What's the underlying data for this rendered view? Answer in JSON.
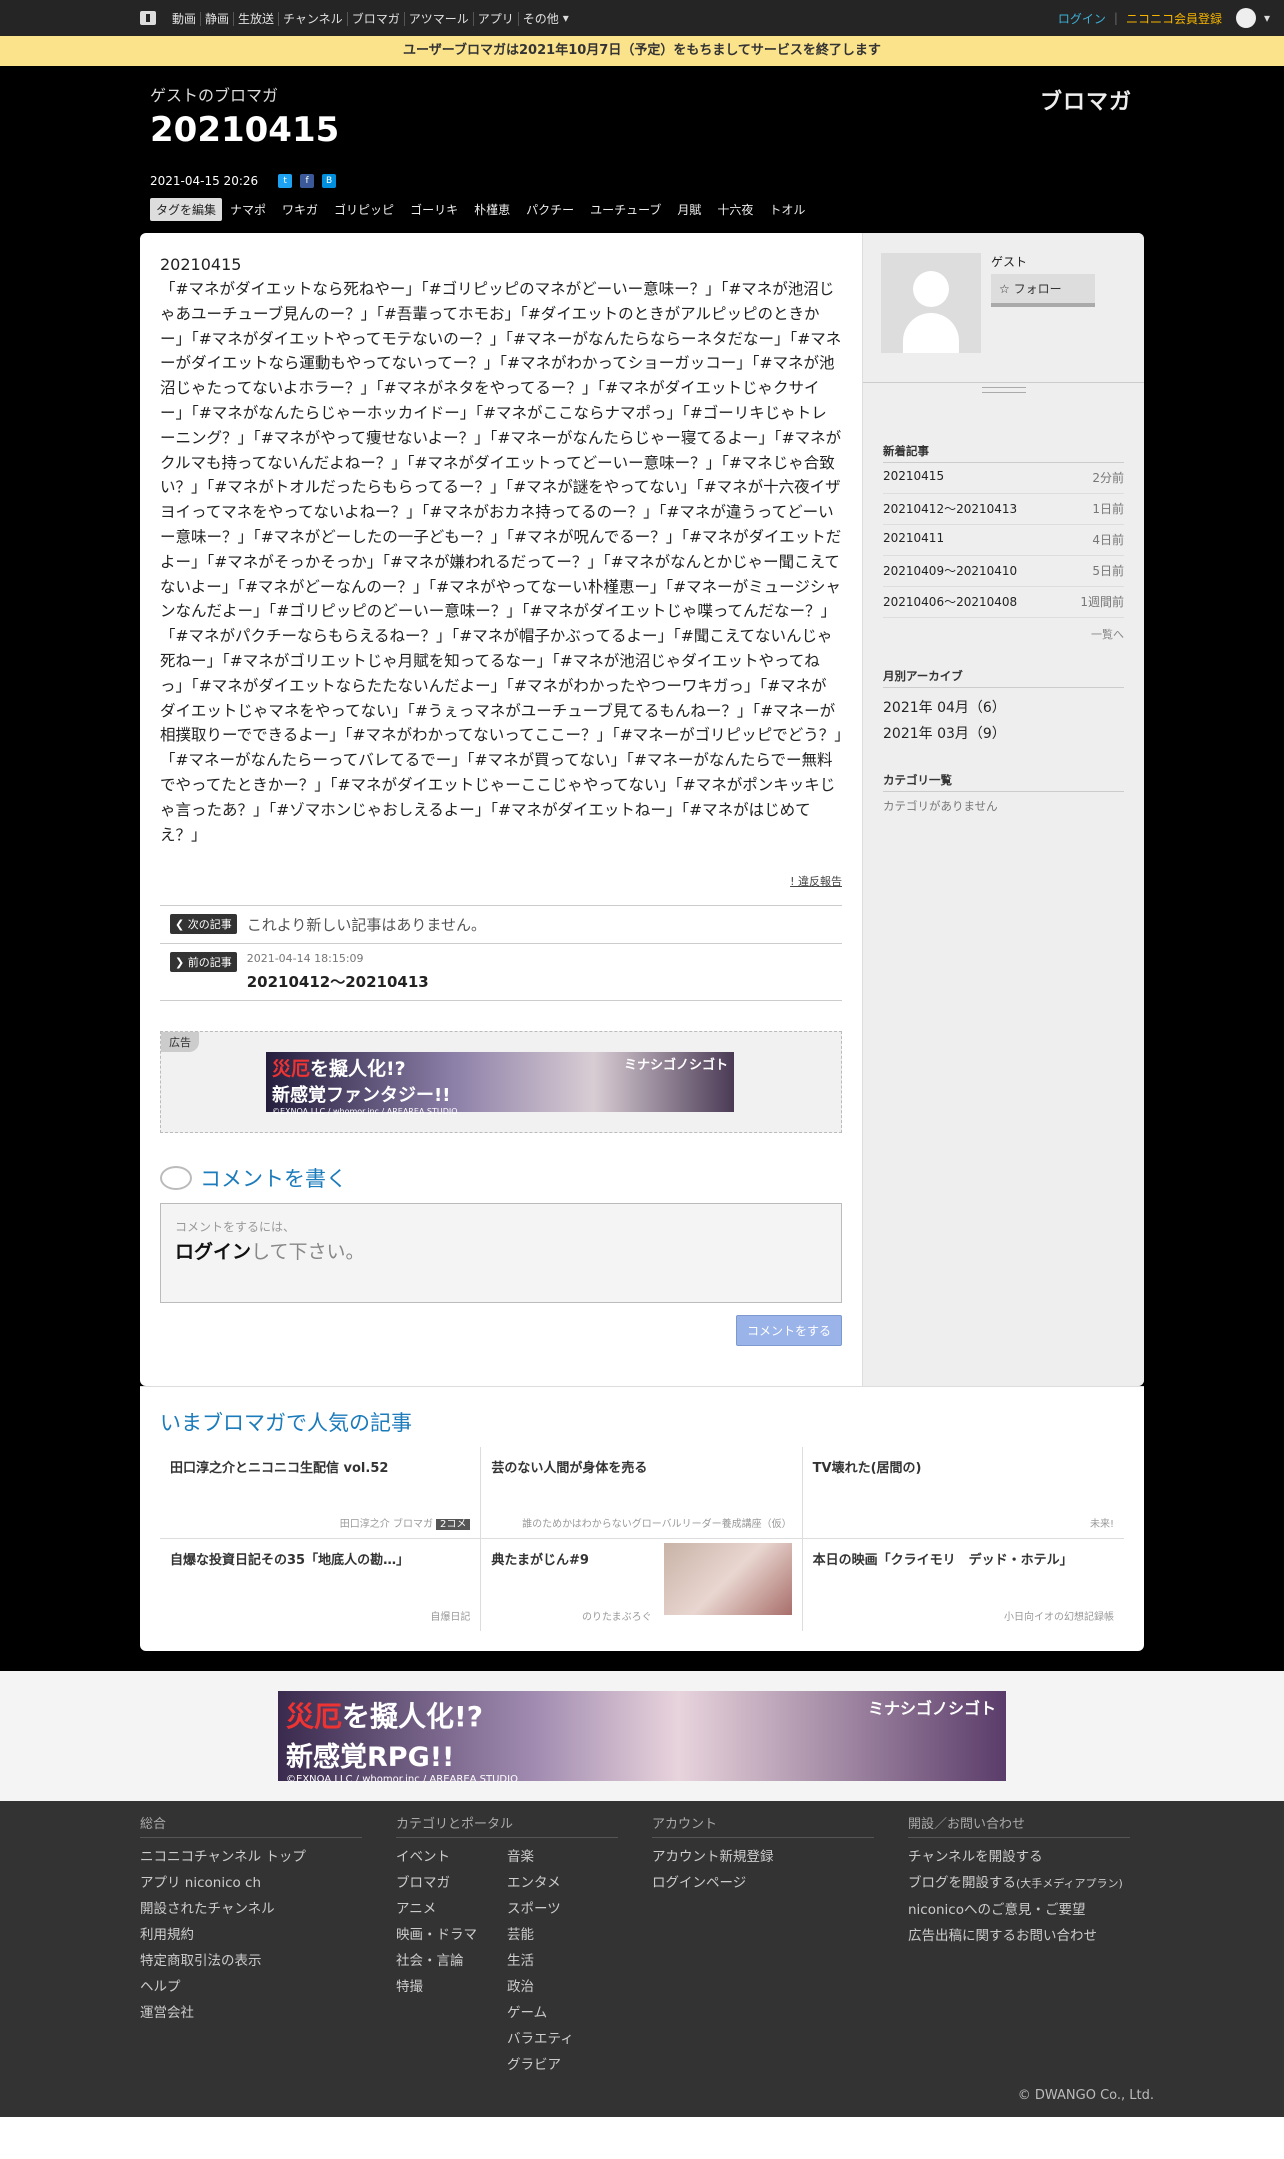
{
  "topbar": {
    "nav": [
      "動画",
      "静画",
      "生放送",
      "チャンネル",
      "ブロマガ",
      "アツマール",
      "アプリ",
      "その他"
    ],
    "login": "ログイン",
    "register": "ニコニコ会員登録"
  },
  "notice": "ユーザーブロマガは2021年10月7日（予定）をもちましてサービスを終了します",
  "header": {
    "owner": "ゲストのブロマガ",
    "title": "20210415",
    "brand": "ブロマガ",
    "date": "2021-04-15 20:26"
  },
  "tags": {
    "edit": "タグを編集",
    "items": [
      "ナマポ",
      "ワキガ",
      "ゴリピッピ",
      "ゴーリキ",
      "朴槿恵",
      "パクチー",
      "ユーチューブ",
      "月賦",
      "十六夜",
      "トオル"
    ]
  },
  "article": {
    "title": "20210415",
    "body": "「#マネがダイエットなら死ねやー」「#ゴリピッピのマネがどーいー意味ー？」「#マネが池沼じゃあユーチューブ見んのー？」「#吾輩ってホモお」「#ダイエットのときがアルピッピのときかー」「#マネがダイエットやってモテないのー？」「#マネーがなんたらならーネタだなー」「#マネーがダイエットなら運動もやってないってー？」「#マネがわかってショーガッコー」「#マネが池沼じゃたってないよホラー？」「#マネがネタをやってるー？」「#マネがダイエットじゃクサイー」「#マネがなんたらじゃーホッカイドー」「#マネがここならナマポっ」「#ゴーリキじゃトレーニング？」「#マネがやって痩せないよー？」「#マネーがなんたらじゃー寝てるよー」「#マネがクルマも持ってないんだよねー？」「#マネがダイエットってどーいー意味ー？」「#マネじゃ合致い？」「#マネがトオルだったらもらってるー？」「#マネが謎をやってない」「#マネが十六夜イザヨイってマネをやってないよねー？」「#マネがおカネ持ってるのー？」「#マネが違うってどーいー意味ー？」「#マネがどーしたの一子どもー？」「#マネが呪んでるー？」「#マネがダイエットだよー」「#マネがそっかそっか」「#マネが嫌われるだってー？」「#マネがなんとかじゃー聞こえてないよー」「#マネがどーなんのー？」「#マネがやってなーい朴槿恵ー」「#マネーがミュージシャンなんだよー」「#ゴリピッピのどーいー意味ー？」「#マネがダイエットじゃ喋ってんだなー？」「#マネがパクチーならもらえるねー？」「#マネが帽子かぶってるよー」「#聞こえてないんじゃ死ねー」「#マネがゴリエットじゃ月賦を知ってるなー」「#マネが池沼じゃダイエットやってねっ」「#マネがダイエットならたたないんだよー」「#マネがわかったやつーワキガっ」「#マネがダイエットじゃマネをやってない」「#うぇっマネがユーチューブ見てるもんねー？」「#マネーが相撲取りーでできるよー」「#マネがわかってないってここー？」「#マネーがゴリピッピでどう？」「#マネーがなんたらーってバレてるでー」「#マネが買ってない」「#マネーがなんたらでー無料でやってたときかー？」「#マネがダイエットじゃーここじゃやってない」「#マネがポンキッキじゃ言ったあ？」「#ゾマホンじゃおしえるよー」「#マネがダイエットねー」「#マネがはじめてえ？」",
    "report": "! 違反報告"
  },
  "navlinks": {
    "next_label": "次の記事",
    "next_text": "これより新しい記事はありません。",
    "prev_label": "前の記事",
    "prev_date": "2021-04-14 18:15:09",
    "prev_title": "20210412～20210413"
  },
  "ad": {
    "label": "広告",
    "line1a": "災厄",
    "line1b": "を擬人化!?",
    "line2": "新感覚ファンタジー!!",
    "brand": "ミナシゴノシゴト",
    "credit": "©EXNOA LLC / whomor.inc / AREAREA STUDIO"
  },
  "comment": {
    "heading": "コメントを書く",
    "small": "コメントをするには、",
    "login": "ログイン",
    "rest": "して下さい。",
    "button": "コメントをする"
  },
  "side": {
    "guest": "ゲスト",
    "follow": "フォロー",
    "recent_h": "新着記事",
    "recent": [
      {
        "t": "20210415",
        "a": "2分前"
      },
      {
        "t": "20210412～20210413",
        "a": "1日前"
      },
      {
        "t": "20210411",
        "a": "4日前"
      },
      {
        "t": "20210409～20210410",
        "a": "5日前"
      },
      {
        "t": "20210406～20210408",
        "a": "1週間前"
      }
    ],
    "more": "一覧へ",
    "archive_h": "月別アーカイブ",
    "archive": [
      "2021年 04月（6）",
      "2021年 03月（9）"
    ],
    "cat_h": "カテゴリ一覧",
    "cat_none": "カテゴリがありません"
  },
  "popular": {
    "heading": "いまブロマガで人気の記事",
    "items": [
      {
        "title": "田口淳之介とニコニコ生配信 vol.52",
        "src": "田口淳之介 ブロマガ",
        "cnt": "2コメ"
      },
      {
        "title": "芸のない人間が身体を売る",
        "src": "誰のためかはわからないグローバルリーダー養成講座（仮）"
      },
      {
        "title": "TV壊れた(居間の)",
        "src": "未来!"
      },
      {
        "title": "自爆な投資日記その35「地底人の勘…」",
        "src": "自爆日記"
      },
      {
        "title": "典たまがじん#9",
        "src": "のりたまぶろぐ"
      },
      {
        "title": "本日の映画「クライモリ　デッド・ホテル」",
        "src": "小日向イオの幻想記録帳"
      }
    ]
  },
  "bottom_ad": {
    "line1a": "災厄",
    "line1b": "を擬人化!?",
    "line2": "新感覚RPG!!",
    "brand": "ミナシゴノシゴト",
    "credit": "©EXNOA LLC / whomor.inc / AREAREA STUDIO"
  },
  "footer": {
    "col1_h": "総合",
    "col1": [
      "ニコニコチャンネル トップ",
      "アプリ niconico ch",
      "開設されたチャンネル",
      "利用規約",
      "特定商取引法の表示",
      "ヘルプ",
      "運営会社"
    ],
    "col2_h": "カテゴリとポータル",
    "col2a": [
      "イベント",
      "ブロマガ",
      "アニメ",
      "映画・ドラマ",
      "社会・言論",
      "特撮"
    ],
    "col2b": [
      "音楽",
      "エンタメ",
      "スポーツ",
      "芸能",
      "生活",
      "政治",
      "ゲーム",
      "バラエティ",
      "グラビア"
    ],
    "col3_h": "アカウント",
    "col3": [
      "アカウント新規登録",
      "ログインページ"
    ],
    "col4_h": "開設／お問い合わせ",
    "col4": [
      "チャンネルを開設する",
      "ブログを開設する",
      "niconicoへのご意見・ご要望",
      "広告出稿に関するお問い合わせ"
    ],
    "col4_small": "(大手メディアプラン)",
    "copyright": "© DWANGO Co., Ltd."
  }
}
